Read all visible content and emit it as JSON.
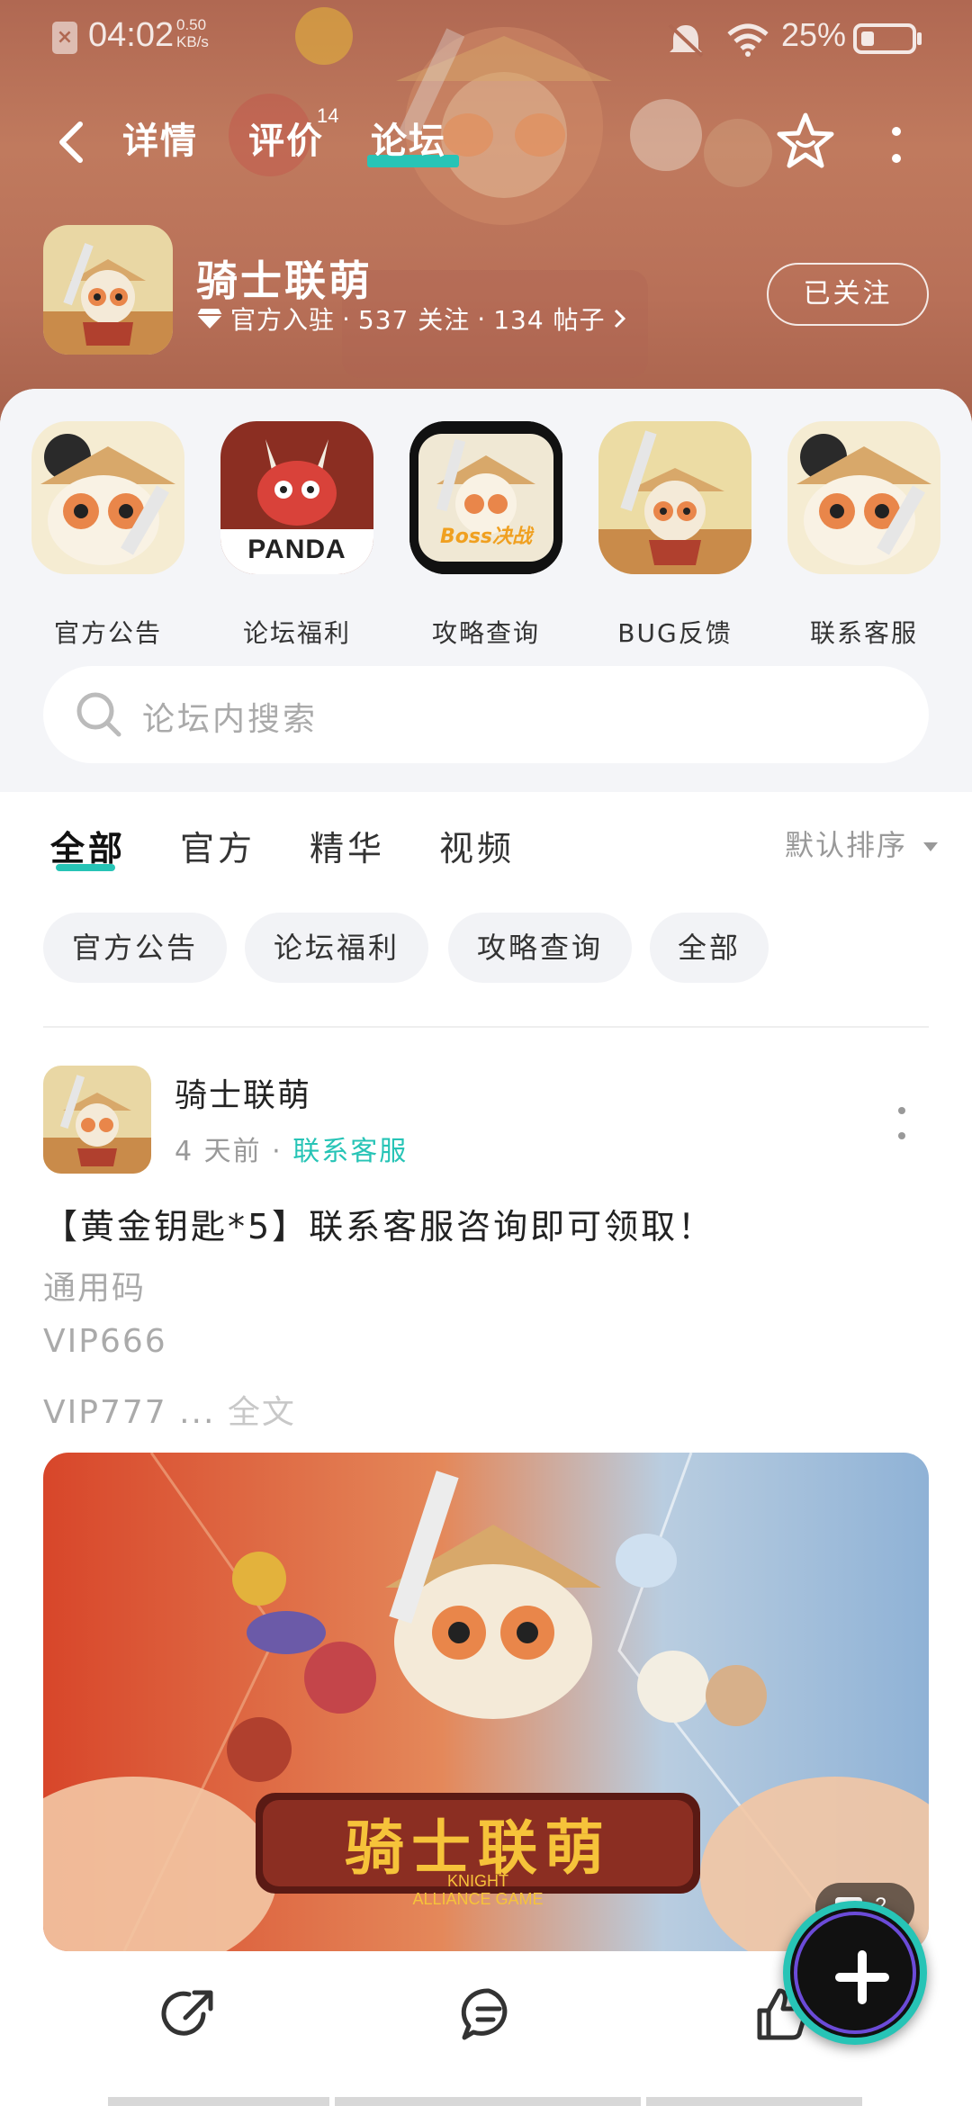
{
  "status_bar": {
    "time": "04:02",
    "net_speed_value": "0.50",
    "net_speed_unit": "KB/s",
    "battery": "25%"
  },
  "nav": {
    "tabs": [
      {
        "label": "详情"
      },
      {
        "label": "评价",
        "badge": "14"
      },
      {
        "label": "论坛"
      }
    ],
    "active_tab": 2,
    "accent_color": "#27c4b6"
  },
  "game": {
    "title": "骑士联萌",
    "verified_label": "官方入驻",
    "followers": "537 关注",
    "posts": "134 帖子",
    "follow_button": "已关注"
  },
  "shortcuts": [
    {
      "label": "官方公告"
    },
    {
      "label": "论坛福利",
      "art_text": "PANDA"
    },
    {
      "label": "攻略查询",
      "art_text": "Boss决战"
    },
    {
      "label": "BUG反馈"
    },
    {
      "label": "联系客服"
    }
  ],
  "search": {
    "placeholder": "论坛内搜索"
  },
  "filter_tabs": [
    "全部",
    "官方",
    "精华",
    "视频"
  ],
  "sort_label": "默认排序",
  "chips": [
    "官方公告",
    "论坛福利",
    "攻略查询",
    "全部"
  ],
  "post": {
    "author": "骑士联萌",
    "time_ago": "4 天前",
    "tag": "联系客服",
    "title": "【黄金钥匙*5】联系客服咨询即可领取！",
    "lines": [
      "通用码",
      "VIP666",
      "VIP777 "
    ],
    "ellipsis": "...",
    "read_more": "全文",
    "image_logo": "骑士联萌",
    "image_logo_sub1": "KNIGHT",
    "image_logo_sub2": "ALLIANCE GAME",
    "image_count": "2"
  },
  "icons": {
    "back": "back-arrow-icon",
    "star": "star-icon",
    "more": "more-vertical-icon",
    "search": "search-icon",
    "share": "share-icon",
    "comment": "comment-icon",
    "like": "like-icon",
    "add": "add-icon"
  }
}
